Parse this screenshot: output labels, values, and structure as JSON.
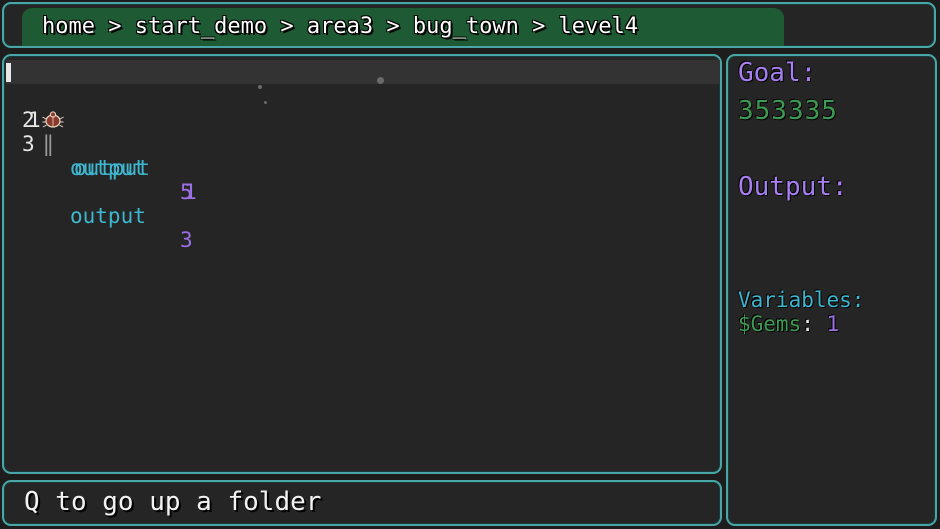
{
  "breadcrumb": "home > start_demo > area3 > bug_town > level4",
  "code": {
    "lines": [
      {
        "number": "1",
        "sep": "|",
        "keyword": "output",
        "value": "1"
      },
      {
        "number": "2",
        "sep": "|",
        "keyword": "output",
        "value": "5"
      },
      {
        "number": "3",
        "sep": "",
        "keyword": "output",
        "value": "3"
      }
    ]
  },
  "side": {
    "goal_label": "Goal:",
    "goal_value": "353335",
    "output_label": "Output:",
    "variables_label": "Variables:",
    "variable": {
      "name": "$Gems",
      "colon": ":",
      "value": "1"
    }
  },
  "hint": "Q to go up a folder",
  "colors": {
    "border": "#4aa6a6",
    "breadcrumb_bg": "#1e5a33",
    "keyword": "#3fb6cf",
    "number": "#9b6fe6",
    "goal_value": "#3e9a52",
    "label_purple": "#a77ff0"
  },
  "icons": {
    "bug": "bug-icon"
  }
}
